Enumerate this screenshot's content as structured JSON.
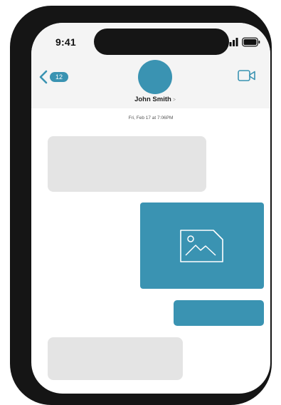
{
  "status_bar": {
    "time": "9:41"
  },
  "header": {
    "back_badge_count": "12",
    "contact_name": "John Smith",
    "contact_chevron": ">",
    "icons": {
      "back": "chevron-left-icon",
      "video": "video-camera-icon"
    }
  },
  "conversation": {
    "timestamp": "Fri, Feb 17 at 7:06PM",
    "messages": [
      {
        "direction": "incoming",
        "kind": "text-placeholder"
      },
      {
        "direction": "outgoing",
        "kind": "image",
        "icon": "image-icon"
      },
      {
        "direction": "outgoing",
        "kind": "text-placeholder"
      },
      {
        "direction": "incoming",
        "kind": "text-placeholder"
      }
    ]
  },
  "colors": {
    "accent": "#3a93b2",
    "incoming_bubble": "#e4e4e4",
    "header_background": "#f4f4f4",
    "device_frame": "#151515"
  }
}
